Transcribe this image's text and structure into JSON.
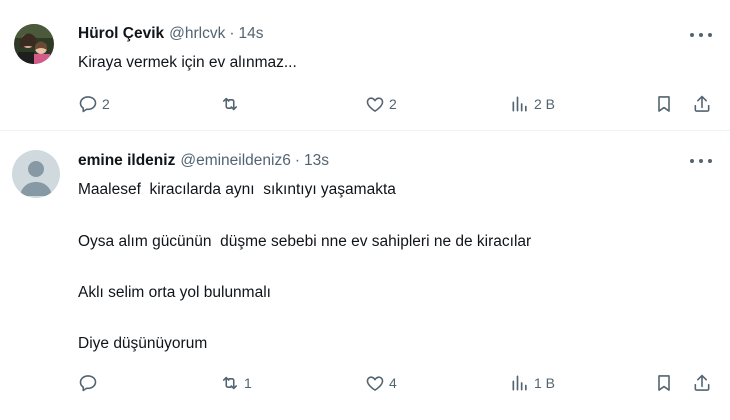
{
  "tweets": [
    {
      "name": "Hürol Çevik",
      "handle": "@hrlcvk",
      "separator": "·",
      "time": "14s",
      "text": "Kiraya vermek için ev alınmaz...",
      "actions": {
        "replies": "2",
        "reposts": "",
        "likes": "2",
        "views": "2 B"
      }
    },
    {
      "name": "emine ildeniz",
      "handle": "@emineildeniz6",
      "separator": "·",
      "time": "13s",
      "paragraphs": [
        "Maalesef  kiracılarda aynı  sıkıntıyı yaşamakta",
        "Oysa alım gücünün  düşme sebebi nne ev sahipleri ne de kiracılar",
        "Aklı selim orta yol bulunmalı",
        "Diye düşünüyorum"
      ],
      "actions": {
        "replies": "",
        "reposts": "1",
        "likes": "4",
        "views": "1 B"
      }
    }
  ],
  "icons": {
    "reply": "reply-icon",
    "repost": "repost-icon",
    "like": "heart-icon",
    "views": "views-icon",
    "bookmark": "bookmark-icon",
    "share": "share-icon",
    "more": "more-icon"
  },
  "colors": {
    "text": "#0f1419",
    "secondary": "#536471",
    "divider": "#eff3f4",
    "default_avatar": "#cfd9de"
  }
}
